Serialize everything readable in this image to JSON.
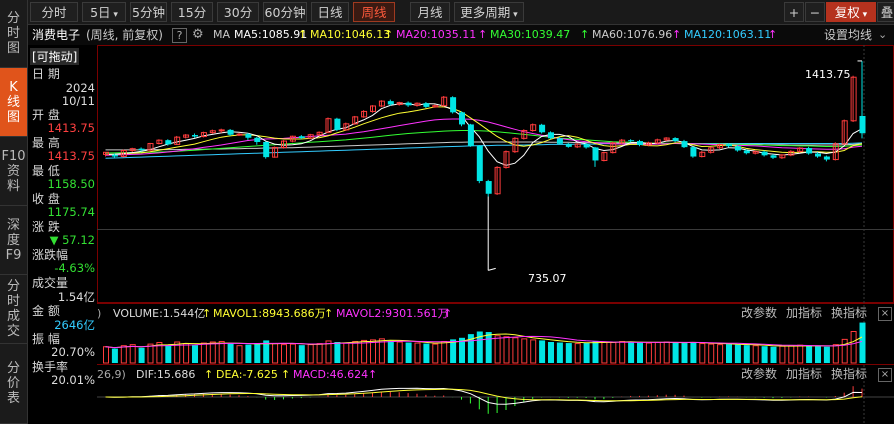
{
  "left_nav": [
    {
      "label": "分时图",
      "active": false,
      "icon": ""
    },
    {
      "label": "K线图",
      "active": true,
      "icon": ""
    },
    {
      "label": "F10资料",
      "active": false,
      "icon": ""
    },
    {
      "label": "深度F9",
      "active": false,
      "icon": ""
    },
    {
      "label": "分时成交",
      "active": false,
      "icon": ""
    },
    {
      "label": "分价表",
      "active": false,
      "icon": ""
    }
  ],
  "toolbar": {
    "periods": [
      "分时",
      "5日",
      "5分钟",
      "15分钟",
      "30分钟",
      "60分钟",
      "日线",
      "周线",
      "月线",
      "更多周期"
    ],
    "active_period": "周线",
    "dropdown_periods": [
      "5日",
      "更多周期"
    ],
    "plus": "+",
    "minus": "−",
    "adjust": "复权",
    "overlay": "叠"
  },
  "ma_row": {
    "stock": "消费电子",
    "mode": "(周线, 前复权)",
    "help": "?",
    "ma_label": "MA",
    "ma5": "MA5:1085.91",
    "ma10": "MA10:1046.13",
    "ma20": "MA20:1035.11",
    "ma30": "MA30:1039.47",
    "ma60": "MA60:1076.96",
    "ma120": "MA120:1063.11",
    "settings": "设置均线"
  },
  "info": {
    "draggable": "[可拖动]",
    "date_label": "日  期",
    "year": "2024",
    "date": "10/11",
    "open_label": "开  盘",
    "open": "1413.75",
    "high_label": "最  高",
    "high": "1413.75",
    "low_label": "最  低",
    "low": "1158.50",
    "close_label": "收  盘",
    "close": "1175.74",
    "change_label": "涨  跌",
    "change": "▼ 57.12",
    "pct_label": "涨跌幅",
    "pct": "-4.63%",
    "volume_label": "成交量",
    "volume": "1.54亿",
    "amount_label": "金  额",
    "amount": "2646亿",
    "amplitude_label": "振  幅",
    "amplitude": "20.70%",
    "turnover_label": "换手率",
    "turnover": "20.01%"
  },
  "volume_panel": {
    "prefix": ")",
    "volume": "VOLUME:1.544亿",
    "mavol1": "MAVOL1:8943.686万",
    "mavol2": "MAVOL2:9301.561万",
    "buttons": [
      "改参数",
      "加指标",
      "换指标"
    ]
  },
  "macd_panel": {
    "prefix": "26,9)",
    "dif": "DIF:15.686",
    "dea": "DEA:-7.625",
    "macd": "MACD:46.624",
    "buttons": [
      "改参数",
      "加指标",
      "换指标"
    ]
  },
  "annotations": {
    "high": "1413.75",
    "low": "735.07"
  },
  "colors": {
    "up": "#ff3c3c",
    "down": "#00e5e5",
    "ma5": "#ffffff",
    "ma10": "#ffff33",
    "ma20": "#ff33ff",
    "ma30": "#33ff33",
    "ma60": "#cccccc",
    "ma120": "#33ccff",
    "accent": "#e0541b"
  },
  "chart_data": {
    "type": "candlestick",
    "price_range": [
      735.07,
      1413.75
    ],
    "candles": [
      [
        1105,
        1112,
        1098,
        1113
      ],
      [
        1104,
        1098,
        1094,
        1108
      ],
      [
        1098,
        1118,
        1095,
        1121
      ],
      [
        1118,
        1124,
        1113,
        1127
      ],
      [
        1124,
        1119,
        1115,
        1128
      ],
      [
        1119,
        1141,
        1117,
        1143
      ],
      [
        1141,
        1152,
        1138,
        1155
      ],
      [
        1152,
        1138,
        1134,
        1155
      ],
      [
        1138,
        1162,
        1136,
        1166
      ],
      [
        1162,
        1169,
        1158,
        1172
      ],
      [
        1169,
        1164,
        1160,
        1174
      ],
      [
        1164,
        1177,
        1161,
        1180
      ],
      [
        1177,
        1183,
        1173,
        1187
      ],
      [
        1183,
        1186,
        1176,
        1190
      ],
      [
        1186,
        1170,
        1166,
        1189
      ],
      [
        1170,
        1172,
        1166,
        1176
      ],
      [
        1172,
        1160,
        1153,
        1176
      ],
      [
        1160,
        1146,
        1137,
        1163
      ],
      [
        1146,
        1096,
        1091,
        1148
      ],
      [
        1096,
        1128,
        1094,
        1131
      ],
      [
        1128,
        1149,
        1124,
        1152
      ],
      [
        1149,
        1165,
        1145,
        1167
      ],
      [
        1165,
        1159,
        1155,
        1169
      ],
      [
        1159,
        1170,
        1155,
        1173
      ],
      [
        1170,
        1178,
        1166,
        1181
      ],
      [
        1178,
        1223,
        1175,
        1227
      ],
      [
        1223,
        1186,
        1182,
        1226
      ],
      [
        1186,
        1206,
        1183,
        1210
      ],
      [
        1206,
        1229,
        1203,
        1232
      ],
      [
        1229,
        1247,
        1226,
        1251
      ],
      [
        1247,
        1265,
        1243,
        1268
      ],
      [
        1265,
        1281,
        1261,
        1284
      ],
      [
        1281,
        1270,
        1266,
        1286
      ],
      [
        1270,
        1276,
        1266,
        1279
      ],
      [
        1276,
        1267,
        1262,
        1280
      ],
      [
        1267,
        1274,
        1263,
        1277
      ],
      [
        1274,
        1262,
        1258,
        1278
      ],
      [
        1262,
        1266,
        1259,
        1270
      ],
      [
        1266,
        1294,
        1263,
        1298
      ],
      [
        1294,
        1244,
        1240,
        1297
      ],
      [
        1244,
        1204,
        1198,
        1247
      ],
      [
        1204,
        1133,
        1130,
        1206
      ],
      [
        1133,
        1017,
        1010,
        1136
      ],
      [
        1017,
        975,
        966,
        1021
      ],
      [
        975,
        1062,
        971,
        1066
      ],
      [
        1062,
        1114,
        1058,
        1118
      ],
      [
        1114,
        1158,
        1110,
        1162
      ],
      [
        1158,
        1184,
        1154,
        1188
      ],
      [
        1184,
        1203,
        1180,
        1207
      ],
      [
        1203,
        1178,
        1174,
        1206
      ],
      [
        1178,
        1158,
        1155,
        1181
      ],
      [
        1158,
        1140,
        1137,
        1162
      ],
      [
        1140,
        1130,
        1127,
        1143
      ],
      [
        1130,
        1139,
        1126,
        1142
      ],
      [
        1139,
        1128,
        1124,
        1143
      ],
      [
        1128,
        1085,
        1064,
        1130
      ],
      [
        1085,
        1111,
        1082,
        1114
      ],
      [
        1111,
        1143,
        1108,
        1147
      ],
      [
        1143,
        1152,
        1139,
        1156
      ],
      [
        1152,
        1149,
        1145,
        1155
      ],
      [
        1149,
        1136,
        1132,
        1153
      ],
      [
        1136,
        1143,
        1132,
        1147
      ],
      [
        1143,
        1153,
        1139,
        1157
      ],
      [
        1153,
        1159,
        1149,
        1162
      ],
      [
        1159,
        1149,
        1145,
        1162
      ],
      [
        1149,
        1129,
        1126,
        1153
      ],
      [
        1129,
        1098,
        1094,
        1132
      ],
      [
        1098,
        1112,
        1095,
        1116
      ],
      [
        1112,
        1127,
        1108,
        1130
      ],
      [
        1127,
        1138,
        1123,
        1141
      ],
      [
        1138,
        1132,
        1128,
        1141
      ],
      [
        1132,
        1118,
        1114,
        1136
      ],
      [
        1118,
        1109,
        1105,
        1122
      ],
      [
        1109,
        1114,
        1105,
        1118
      ],
      [
        1114,
        1102,
        1098,
        1118
      ],
      [
        1102,
        1094,
        1090,
        1106
      ],
      [
        1094,
        1103,
        1090,
        1106
      ],
      [
        1103,
        1115,
        1099,
        1119
      ],
      [
        1115,
        1126,
        1111,
        1129
      ],
      [
        1126,
        1108,
        1104,
        1130
      ],
      [
        1108,
        1098,
        1094,
        1112
      ],
      [
        1098,
        1088,
        1082,
        1101
      ],
      [
        1088,
        1140,
        1085,
        1145
      ],
      [
        1140,
        1216,
        1136,
        1220
      ],
      [
        1216,
        1360,
        1212,
        1365
      ],
      [
        1232,
        1175,
        1158,
        1413
      ]
    ],
    "ma_series": {
      "ma5": [
        1105,
        1106,
        1108,
        1111,
        1115,
        1121,
        1130,
        1139,
        1146,
        1152,
        1158,
        1166,
        1171,
        1176,
        1180,
        1178,
        1175,
        1167,
        1149,
        1139,
        1135,
        1137,
        1140,
        1150,
        1165,
        1179,
        1188,
        1193,
        1207,
        1219,
        1234,
        1256,
        1267,
        1272,
        1273,
        1267,
        1273,
        1272,
        1265,
        1253,
        1232,
        1196,
        1163,
        1116,
        1081,
        1069,
        1076,
        1102,
        1144,
        1164,
        1171,
        1171,
        1164,
        1146,
        1140,
        1125,
        1118,
        1121,
        1131,
        1144,
        1145,
        1140,
        1142,
        1149,
        1151,
        1145,
        1131,
        1120,
        1119,
        1120,
        1127,
        1126,
        1120,
        1116,
        1109,
        1106,
        1103,
        1105,
        1109,
        1113,
        1112,
        1108,
        1113,
        1133,
        1174,
        1190
      ],
      "ma10": [
        1105,
        1105,
        1107,
        1109,
        1110,
        1114,
        1119,
        1124,
        1129,
        1134,
        1139,
        1147,
        1155,
        1162,
        1166,
        1169,
        1170,
        1167,
        1163,
        1159,
        1156,
        1156,
        1156,
        1158,
        1160,
        1166,
        1176,
        1185,
        1195,
        1206,
        1216,
        1226,
        1234,
        1241,
        1245,
        1250,
        1256,
        1262,
        1262,
        1257,
        1245,
        1226,
        1206,
        1185,
        1164,
        1148,
        1136,
        1132,
        1136,
        1144,
        1155,
        1163,
        1167,
        1162,
        1152,
        1141,
        1134,
        1131,
        1134,
        1138,
        1138,
        1134,
        1133,
        1137,
        1143,
        1143,
        1137,
        1131,
        1132,
        1134,
        1136,
        1132,
        1125,
        1121,
        1118,
        1115,
        1112,
        1111,
        1112,
        1113,
        1114,
        1112,
        1112,
        1118,
        1134,
        1140
      ],
      "ma20": [
        1102,
        1103,
        1104,
        1105,
        1106,
        1108,
        1110,
        1113,
        1116,
        1120,
        1124,
        1128,
        1132,
        1136,
        1141,
        1146,
        1151,
        1154,
        1156,
        1157,
        1158,
        1160,
        1162,
        1164,
        1166,
        1168,
        1170,
        1172,
        1176,
        1180,
        1185,
        1190,
        1195,
        1200,
        1205,
        1210,
        1215,
        1219,
        1221,
        1222,
        1222,
        1221,
        1218,
        1212,
        1204,
        1196,
        1188,
        1180,
        1174,
        1168,
        1163,
        1158,
        1154,
        1150,
        1147,
        1144,
        1142,
        1140,
        1139,
        1139,
        1139,
        1139,
        1139,
        1140,
        1141,
        1141,
        1140,
        1139,
        1138,
        1137,
        1136,
        1135,
        1134,
        1133,
        1131,
        1129,
        1127,
        1126,
        1125,
        1124,
        1123,
        1122,
        1122,
        1124,
        1129,
        1132
      ],
      "ma30": [
        1110,
        1110,
        1111,
        1111,
        1112,
        1112,
        1113,
        1114,
        1115,
        1117,
        1119,
        1121,
        1123,
        1125,
        1127,
        1129,
        1131,
        1133,
        1135,
        1137,
        1139,
        1141,
        1143,
        1145,
        1147,
        1149,
        1151,
        1153,
        1156,
        1159,
        1162,
        1165,
        1168,
        1171,
        1174,
        1176,
        1178,
        1180,
        1182,
        1183,
        1184,
        1184,
        1183,
        1182,
        1180,
        1177,
        1174,
        1171,
        1168,
        1165,
        1162,
        1159,
        1157,
        1155,
        1153,
        1151,
        1149,
        1147,
        1146,
        1145,
        1144,
        1143,
        1142,
        1142,
        1141,
        1141,
        1140,
        1140,
        1139,
        1139,
        1138,
        1138,
        1137,
        1137,
        1136,
        1135,
        1134,
        1134,
        1133,
        1133,
        1132,
        1131,
        1131,
        1132,
        1134,
        1136
      ],
      "ma60": [
        1120,
        1120,
        1120,
        1120,
        1120,
        1121,
        1121,
        1121,
        1121,
        1122,
        1122,
        1122,
        1123,
        1123,
        1124,
        1124,
        1125,
        1125,
        1126,
        1126,
        1127,
        1127,
        1128,
        1129,
        1130,
        1131,
        1132,
        1133,
        1134,
        1135,
        1136,
        1137,
        1138,
        1139,
        1140,
        1141,
        1142,
        1143,
        1144,
        1145,
        1145,
        1146,
        1146,
        1146,
        1146,
        1146,
        1146,
        1146,
        1146,
        1146,
        1145,
        1145,
        1145,
        1144,
        1144,
        1144,
        1143,
        1143,
        1143,
        1142,
        1142,
        1142,
        1141,
        1141,
        1141,
        1140,
        1140,
        1140,
        1139,
        1139,
        1139,
        1138,
        1138,
        1138,
        1137,
        1137,
        1137,
        1136,
        1136,
        1136,
        1136,
        1136,
        1136,
        1137,
        1138,
        1140
      ],
      "ma120": [
        1092,
        1093,
        1094,
        1095,
        1096,
        1097,
        1098,
        1099,
        1100,
        1101,
        1102,
        1103,
        1104,
        1105,
        1106,
        1107,
        1108,
        1109,
        1110,
        1111,
        1112,
        1113,
        1114,
        1115,
        1116,
        1117,
        1118,
        1119,
        1120,
        1121,
        1122,
        1123,
        1124,
        1125,
        1126,
        1127,
        1128,
        1129,
        1130,
        1131,
        1132,
        1133,
        1134,
        1134,
        1135,
        1135,
        1136,
        1136,
        1137,
        1137,
        1138,
        1138,
        1138,
        1139,
        1139,
        1139,
        1140,
        1140,
        1140,
        1141,
        1141,
        1141,
        1141,
        1141,
        1141,
        1141,
        1141,
        1141,
        1141,
        1141,
        1141,
        1141,
        1141,
        1141,
        1141,
        1141,
        1141,
        1141,
        1141,
        1141,
        1141,
        1141,
        1141,
        1141,
        1142,
        1143
      ]
    },
    "volume": [
      62,
      55,
      66,
      70,
      58,
      72,
      78,
      70,
      80,
      74,
      68,
      76,
      80,
      82,
      74,
      66,
      70,
      72,
      86,
      74,
      70,
      72,
      68,
      70,
      74,
      84,
      80,
      76,
      82,
      86,
      88,
      92,
      84,
      80,
      78,
      76,
      74,
      72,
      82,
      90,
      96,
      110,
      120,
      118,
      104,
      100,
      96,
      92,
      88,
      86,
      80,
      78,
      76,
      74,
      76,
      84,
      80,
      78,
      82,
      80,
      78,
      76,
      78,
      80,
      78,
      76,
      80,
      74,
      72,
      70,
      72,
      70,
      68,
      66,
      64,
      62,
      64,
      66,
      68,
      66,
      64,
      62,
      70,
      90,
      120,
      154
    ]
  }
}
